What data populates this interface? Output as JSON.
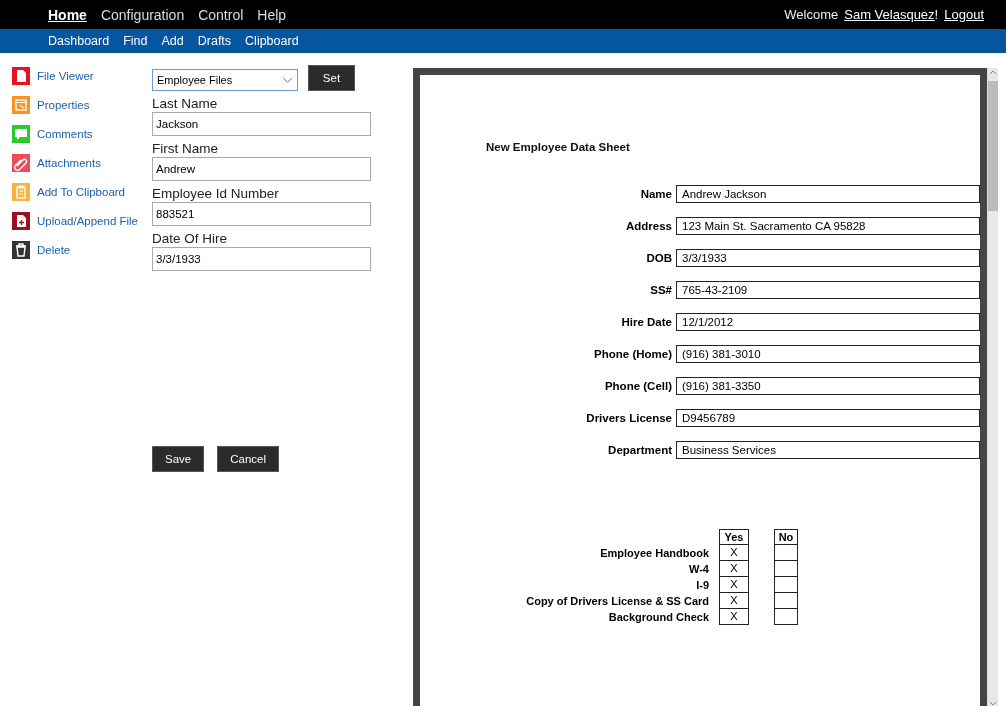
{
  "top_menu": [
    {
      "label": "Home",
      "selected": true
    },
    {
      "label": "Configuration",
      "selected": false
    },
    {
      "label": "Control",
      "selected": false
    },
    {
      "label": "Help",
      "selected": false
    }
  ],
  "user_area": {
    "welcome": "Welcome",
    "user_name": "Sam Velasquez",
    "punctuation": "!",
    "logout": "Logout"
  },
  "sub_menu": [
    "Dashboard",
    "Find",
    "Add",
    "Drafts",
    "Clipboard"
  ],
  "sidebar": {
    "items": [
      {
        "label": "File Viewer",
        "kind": "file",
        "color": "#e81123"
      },
      {
        "label": "Properties",
        "kind": "window",
        "color": "#f7941d"
      },
      {
        "label": "Comments",
        "kind": "comment",
        "color": "#2cc92c"
      },
      {
        "label": "Attachments",
        "kind": "clip",
        "color": "#ee4a5a"
      },
      {
        "label": "Add To Clipboard",
        "kind": "clipboard",
        "color": "#fbb040"
      },
      {
        "label": "Upload/Append File",
        "kind": "upload",
        "color": "#9b0f1e"
      },
      {
        "label": "Delete",
        "kind": "trash",
        "color": "#333333"
      }
    ]
  },
  "form": {
    "file_type": {
      "value": "Employee Files"
    },
    "set_button": "Set",
    "fields": [
      {
        "label": "Last Name",
        "value": "Jackson"
      },
      {
        "label": "First Name",
        "value": "Andrew"
      },
      {
        "label": "Employee Id Number",
        "value": "883521"
      },
      {
        "label": "Date Of Hire",
        "value": "3/3/1933"
      }
    ],
    "buttons": [
      "Save",
      "Cancel"
    ]
  },
  "document": {
    "title": "New Employee Data Sheet",
    "fields": [
      {
        "label": "Name",
        "value": "Andrew Jackson"
      },
      {
        "label": "Address",
        "value": "123 Main St. Sacramento CA 95828"
      },
      {
        "label": "DOB",
        "value": "3/3/1933"
      },
      {
        "label": "SS#",
        "value": "765-43-2109"
      },
      {
        "label": "Hire Date",
        "value": "12/1/2012"
      },
      {
        "label": "Phone (Home)",
        "value": "(916) 381-3010"
      },
      {
        "label": "Phone (Cell)",
        "value": "(916) 381-3350"
      },
      {
        "label": "Drivers License",
        "value": "D9456789"
      },
      {
        "label": "Department",
        "value": "Business Services"
      }
    ],
    "checklist": {
      "columns": [
        "Yes",
        "No"
      ],
      "rows": [
        {
          "label": "Employee Handbook",
          "yes": "X"
        },
        {
          "label": "W-4",
          "yes": "X"
        },
        {
          "label": "I-9",
          "yes": "X"
        },
        {
          "label": "Copy of Drivers License & SS Card",
          "yes": "X"
        },
        {
          "label": "Background Check",
          "yes": "X"
        }
      ]
    }
  }
}
